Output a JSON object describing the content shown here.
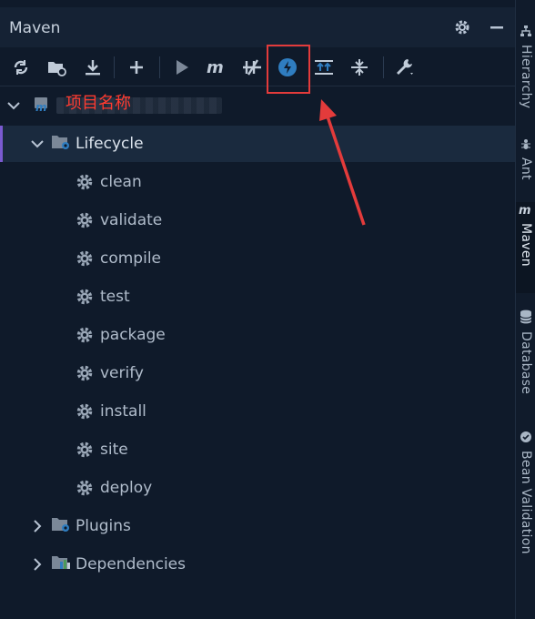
{
  "panel": {
    "title": "Maven",
    "annotation": "项目名称"
  },
  "toolbar": {
    "buttons": [
      {
        "name": "reload-icon"
      },
      {
        "name": "folder-sync-icon"
      },
      {
        "name": "download-icon"
      },
      {
        "name": "add-icon"
      },
      {
        "name": "run-icon"
      },
      {
        "name": "maven-goal-icon"
      },
      {
        "name": "skip-tests-icon"
      },
      {
        "name": "offline-mode-icon"
      },
      {
        "name": "show-dependencies-icon"
      },
      {
        "name": "collapse-all-icon"
      },
      {
        "name": "settings-wrench-icon"
      }
    ]
  },
  "tree": {
    "lifecycle_label": "Lifecycle",
    "phases": [
      "clean",
      "validate",
      "compile",
      "test",
      "package",
      "verify",
      "install",
      "site",
      "deploy"
    ],
    "plugins_label": "Plugins",
    "dependencies_label": "Dependencies"
  },
  "sidebar": {
    "tabs": [
      "Hierarchy",
      "Ant",
      "Maven",
      "Database",
      "Bean Validation"
    ]
  },
  "colors": {
    "background": "#0f1a2a",
    "highlight": "#e33b3b",
    "accent_blue": "#2f7dc0"
  }
}
